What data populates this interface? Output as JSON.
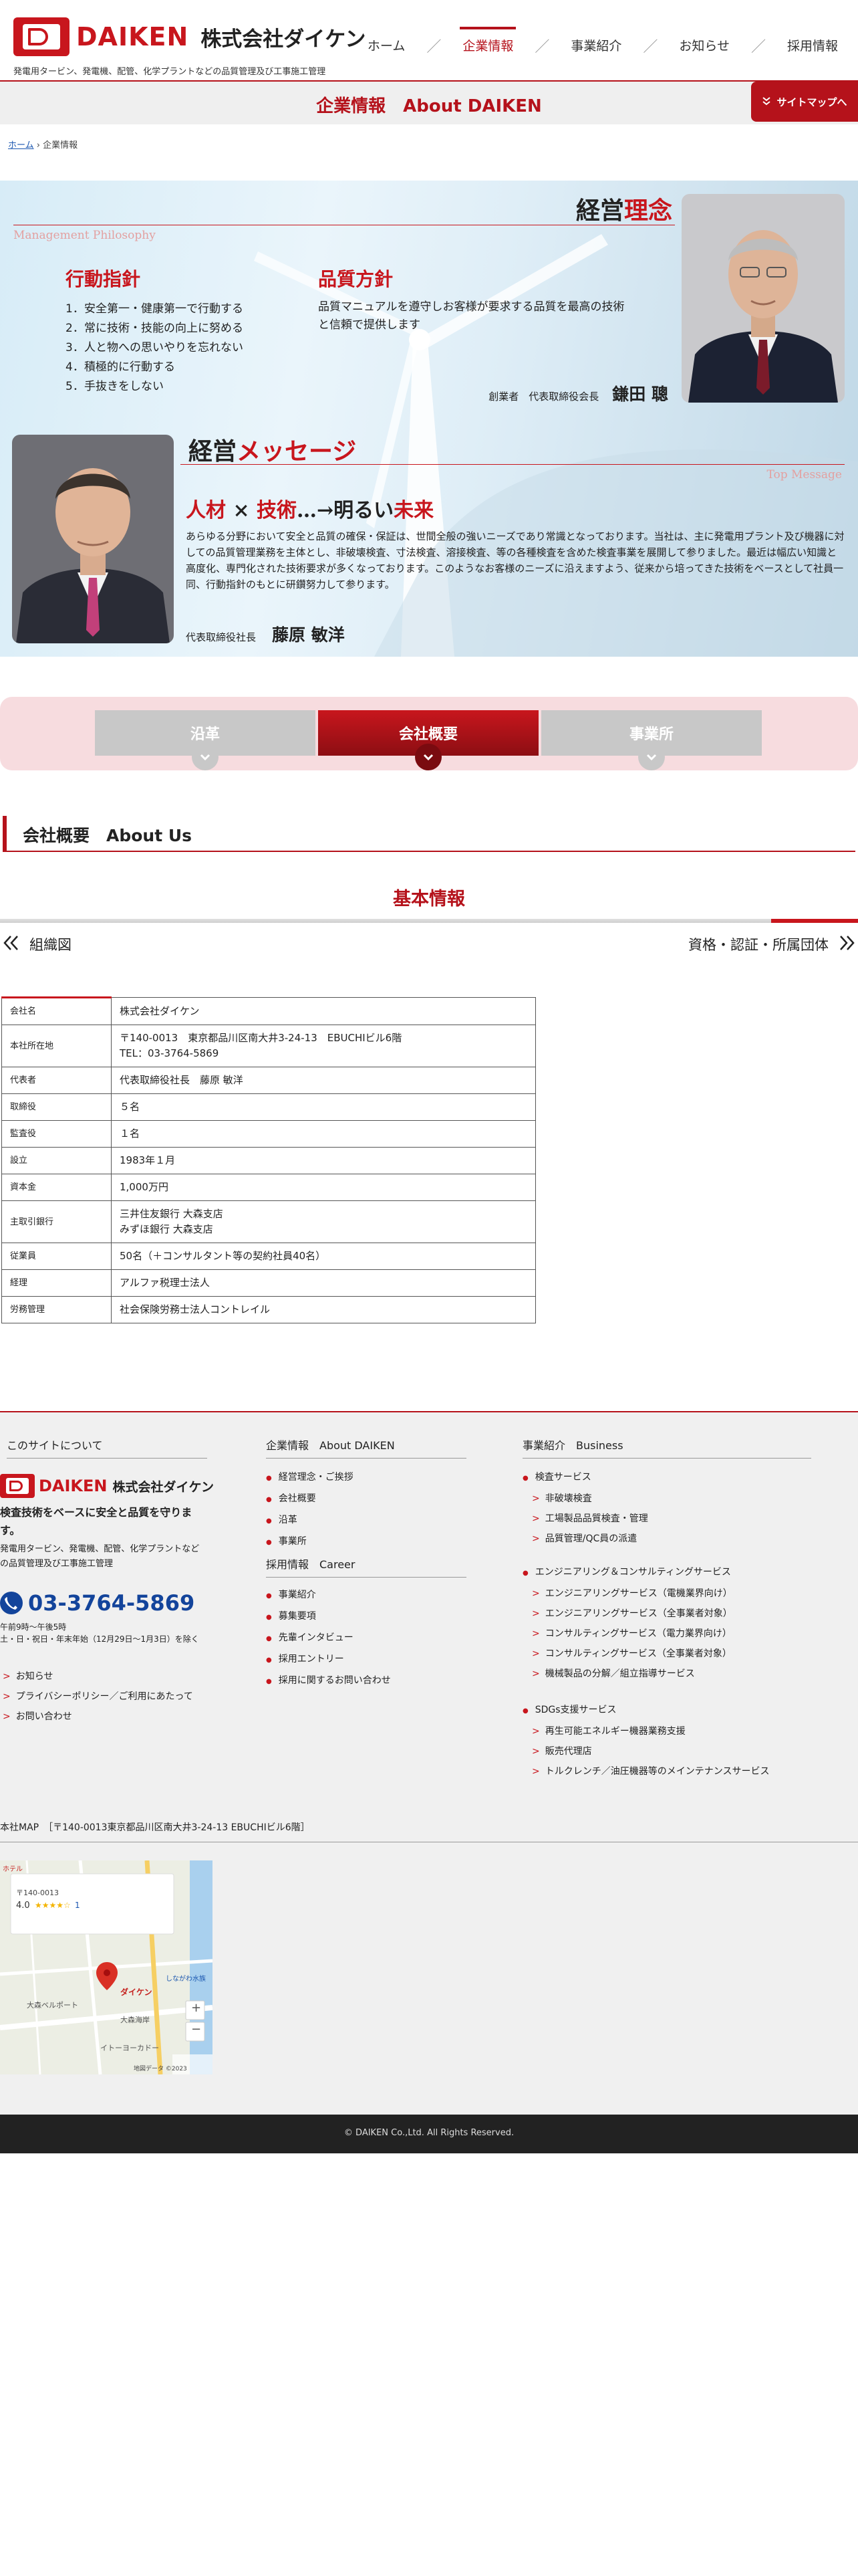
{
  "header": {
    "logo_word": "DAIKEN",
    "company": "株式会社ダイケン",
    "tagline": "発電用タービン、発電機、配管、化学プラントなどの品質管理及び工事施工管理",
    "nav": [
      {
        "label": "ホーム"
      },
      {
        "label": "企業情報"
      },
      {
        "label": "事業紹介"
      },
      {
        "label": "お知らせ"
      },
      {
        "label": "採用情報"
      }
    ],
    "nav_sep": "／"
  },
  "title_bar": {
    "title": "企業情報　About DAIKEN",
    "sitemap_label": "サイトマップへ",
    "sitemap_icon": "double-chevron-down-icon"
  },
  "breadcrumb": {
    "home": "ホーム",
    "sep": " › ",
    "current": "企業情報"
  },
  "philosophy": {
    "title_a": "経営",
    "title_b": "理念",
    "en": "Management Philosophy",
    "action_title": "行動指針",
    "action_items": [
      {
        "n": "1．",
        "t": "安全第一・健康第一で行動する"
      },
      {
        "n": "2．",
        "t": "常に技術・技能の向上に努める"
      },
      {
        "n": "3．",
        "t": "人と物への思いやりを忘れない"
      },
      {
        "n": "4．",
        "t": "積極的に行動する"
      },
      {
        "n": "5．",
        "t": "手抜きをしない"
      }
    ],
    "quality_title": "品質方針",
    "quality_text": "品質マニュアルを遵守しお客様が要求する品質を最高の技術と信頼で提供します",
    "founder_role": "創業者　代表取締役会長",
    "founder_name": "鎌田 聰"
  },
  "message": {
    "title_a": "経営",
    "title_b": "メッセージ",
    "en": "Top Message",
    "catch_a": "人材",
    "catch_x": " × ",
    "catch_b": "技術",
    "catch_c": "…→明るい",
    "catch_d": "未来",
    "body": "あらゆる分野において安全と品質の確保・保証は、世間全般の強いニーズであり常識となっております。当社は、主に発電用プラント及び機器に対しての品質管理業務を主体とし、非破壊検査、寸法検査、溶接検査、等の各種検査を含めた検査事業を展開して参りました。最近は幅広い知識と高度化、専門化された技術要求が多くなっております。このようなお客様のニーズに沿えますよう、従来から培ってきた技術をベースとして社員一同、行動指針のもとに研鑽努力して参ります。",
    "president_role": "代表取締役社長",
    "president_name": "藤原 敏洋"
  },
  "tabs": [
    {
      "label": "沿革"
    },
    {
      "label": "会社概要"
    },
    {
      "label": "事業所"
    }
  ],
  "section": {
    "heading": "会社概要　About Us",
    "basic_title": "基本情報",
    "link_org": "組織図",
    "link_cert": "資格・認証・所属団体"
  },
  "company_table": [
    {
      "k": "会社名",
      "v": [
        "株式会社ダイケン"
      ]
    },
    {
      "k": "本社所在地",
      "v": [
        "〒140-0013　東京都品川区南大井3-24-13　EBUCHIビル6階",
        "TEL：03-3764-5869"
      ]
    },
    {
      "k": "代表者",
      "v": [
        "代表取締役社長　藤原 敏洋"
      ]
    },
    {
      "k": "取締役",
      "v": [
        "５名"
      ]
    },
    {
      "k": "監査役",
      "v": [
        "１名"
      ]
    },
    {
      "k": "設立",
      "v": [
        "1983年１月"
      ]
    },
    {
      "k": "資本金",
      "v": [
        "1,000万円"
      ]
    },
    {
      "k": "主取引銀行",
      "v": [
        "三井住友銀行 大森支店",
        "みずほ銀行 大森支店"
      ]
    },
    {
      "k": "従業員",
      "v": [
        "50名（＋コンサルタント等の契約社員40名）"
      ]
    },
    {
      "k": "経理",
      "v": [
        "アルファ税理士法人"
      ]
    },
    {
      "k": "労務管理",
      "v": [
        "社会保険労務士法人コントレイル"
      ]
    }
  ],
  "footer": {
    "about_head": "このサイトについて",
    "logo_word": "DAIKEN",
    "company": "株式会社ダイケン",
    "slogan": "検査技術をベースに安全と品質を守ります。",
    "desc": "発電用タービン、発電機、配管、化学プラントなどの品質管理及び工事施工管理",
    "phone": "03-3764-5869",
    "hours_1": "午前9時〜午後5時",
    "hours_2": "土・日・祝日・年末年始（12月29日〜1月3日）を除く",
    "about_links": [
      "お知らせ",
      "プライバシーポリシー／ご利用にあたって",
      "お問い合わせ"
    ],
    "corp_head": "企業情報　About DAIKEN",
    "corp_links": [
      "経営理念・ご挨拶",
      "会社概要",
      "沿革",
      "事業所"
    ],
    "career_head": "採用情報　Career",
    "career_links": [
      "事業紹介",
      "募集要項",
      "先輩インタビュー",
      "採用エントリー",
      "採用に関するお問い合わせ"
    ],
    "biz_head": "事業紹介　Business",
    "biz_groups": [
      {
        "title": "検査サービス",
        "items": [
          "非破壊検査",
          "工場製品品質検査・管理",
          "品質管理/QC員の派遣"
        ]
      },
      {
        "title": "エンジニアリング＆コンサルティングサービス",
        "items": [
          "エンジニアリングサービス（電機業界向け）",
          "エンジニアリングサービス（全事業者対象）",
          "コンサルティングサービス（電力業界向け）",
          "コンサルティングサービス（全事業者対象）",
          "機械製品の分解／組立指導サービス"
        ]
      },
      {
        "title": "SDGs支援サービス",
        "items": [
          "再生可能エネルギー機器業務支援",
          "販売代理店",
          "トルクレンチ／油圧機器等のメインテナンスサービス"
        ]
      }
    ],
    "map_label": "本社MAP　［〒140-0013東京都品川区南大井3-24-13 EBUCHIビル6階］",
    "map": {
      "postal": "〒140-0013",
      "rating": "4.0",
      "stars": "★★★★☆",
      "review_count": "1",
      "pin_label": "ダイケン",
      "zoom_in": "+",
      "zoom_out": "−",
      "place_1": "大森ベルポート",
      "place_2": "大森海岸",
      "place_3": "イトーヨーカドー",
      "place_4": "しながわ水族",
      "place_5": "ホテル",
      "attrib": "地図データ ©2023"
    },
    "copyright": "© DAIKEN Co.,Ltd. All Rights Reserved."
  },
  "colors": {
    "brand_red": "#c8161d",
    "dark_red": "#b5121b",
    "phone_blue": "#13449b"
  }
}
